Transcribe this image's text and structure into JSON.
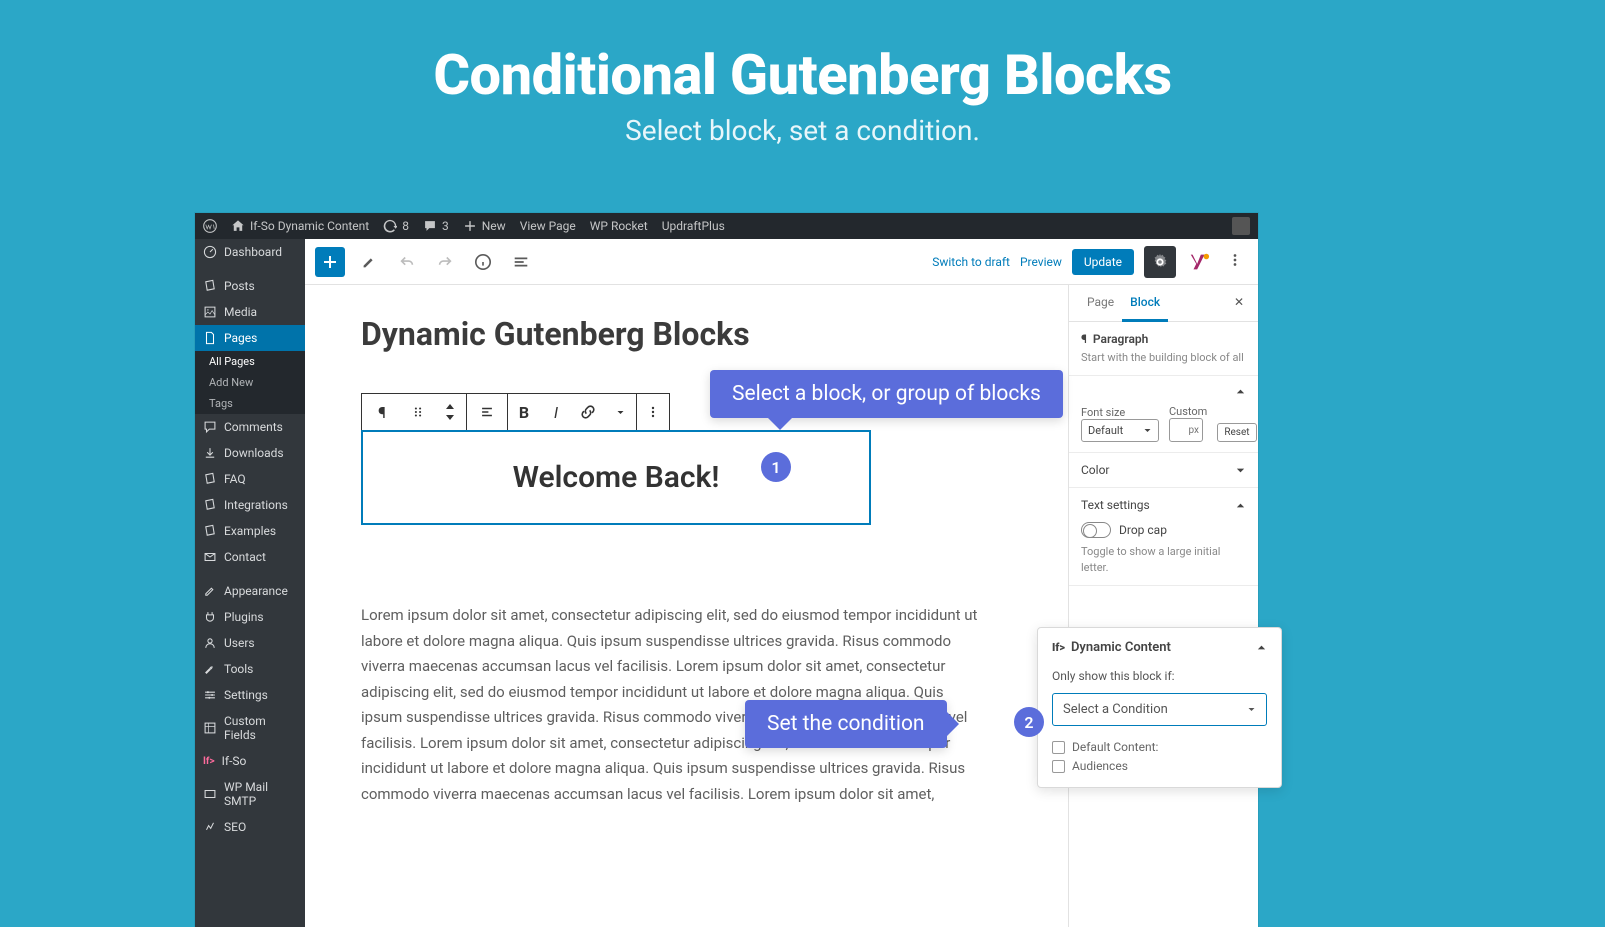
{
  "hero": {
    "title": "Conditional Gutenberg Blocks",
    "subtitle": "Select block, set a condition."
  },
  "adminbar": {
    "site": "If-So Dynamic Content",
    "updates": "8",
    "comments": "3",
    "new": "New",
    "viewpage": "View Page",
    "wprocket": "WP Rocket",
    "updraft": "UpdraftPlus"
  },
  "sidebar": {
    "dashboard": "Dashboard",
    "posts": "Posts",
    "media": "Media",
    "pages": "Pages",
    "allpages": "All Pages",
    "addnew": "Add New",
    "tags": "Tags",
    "comments": "Comments",
    "downloads": "Downloads",
    "faq": "FAQ",
    "integrations": "Integrations",
    "examples": "Examples",
    "contact": "Contact",
    "appearance": "Appearance",
    "plugins": "Plugins",
    "users": "Users",
    "tools": "Tools",
    "settings": "Settings",
    "customfields": "Custom Fields",
    "ifso": "If-So",
    "wpmail": "WP Mail SMTP",
    "seo": "SEO"
  },
  "topbar": {
    "switch": "Switch to draft",
    "preview": "Preview",
    "update": "Update"
  },
  "editor": {
    "title": "Dynamic Gutenberg Blocks",
    "block_text": "Welcome Back!",
    "lorem": "Lorem ipsum dolor sit amet, consectetur adipiscing elit, sed do eiusmod tempor incididunt ut labore et dolore magna aliqua. Quis ipsum suspendisse ultrices gravida. Risus commodo viverra maecenas accumsan lacus vel facilisis. Lorem ipsum dolor sit amet, consectetur adipiscing elit, sed do eiusmod tempor incididunt ut labore et dolore magna aliqua. Quis ipsum suspendisse ultrices gravida. Risus commodo viverra maecenas accumsan lacus vel facilisis. Lorem ipsum dolor sit amet, consectetur adipiscing elit, sed do eiusmod tempor incididunt ut labore et dolore magna aliqua. Quis ipsum suspendisse ultrices gravida. Risus commodo viverra maecenas accumsan lacus vel facilisis. Lorem ipsum dolor sit amet,"
  },
  "rightpanel": {
    "tab_page": "Page",
    "tab_block": "Block",
    "blocktype": "Paragraph",
    "blockdesc": "Start with the building block of all",
    "fontsize_label": "Font size",
    "custom_label": "Custom",
    "fontsize_value": "Default",
    "custom_ph": "px",
    "reset": "Reset",
    "color": "Color",
    "text_settings": "Text settings",
    "dropcap": "Drop cap",
    "dropcap_desc": "Toggle to show a large initial letter."
  },
  "dynamic": {
    "title": "Dynamic Content",
    "label": "Only show this block if:",
    "placeholder": "Select a Condition",
    "check1": "Default Content:",
    "check2": "Audiences"
  },
  "callouts": {
    "c1": "Select a block, or group of blocks",
    "c2": "Set the condition",
    "n1": "1",
    "n2": "2"
  }
}
